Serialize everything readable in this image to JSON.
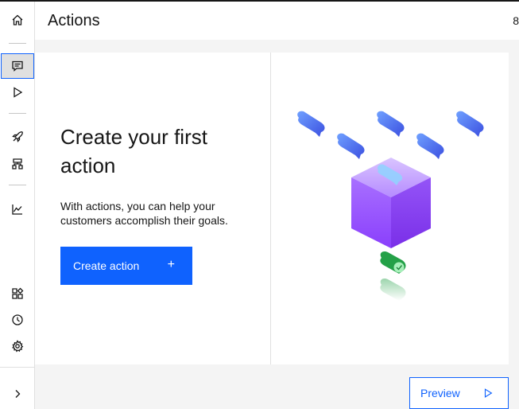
{
  "header": {
    "title": "Actions",
    "overflow_text": "8"
  },
  "rail": {
    "items": [
      {
        "name": "home-icon"
      },
      {
        "name": "actions-icon",
        "active": true
      },
      {
        "name": "preview-play-icon"
      },
      {
        "name": "publish-rocket-icon"
      },
      {
        "name": "environments-icon"
      },
      {
        "name": "analytics-icon"
      },
      {
        "name": "integrations-icon"
      },
      {
        "name": "history-icon"
      },
      {
        "name": "settings-gear-icon"
      },
      {
        "name": "expand-chevron-icon"
      }
    ]
  },
  "empty_state": {
    "headline": "Create your first action",
    "body": "With actions, you can help your customers accomplish their goals.",
    "create_button_label": "Create action",
    "create_button_icon": "+"
  },
  "footer": {
    "preview_label": "Preview"
  },
  "colors": {
    "primary": "#0f62fe",
    "cube": "#9a5bf0",
    "bubble": "#4a6bf5",
    "toggle": "#24a148"
  }
}
